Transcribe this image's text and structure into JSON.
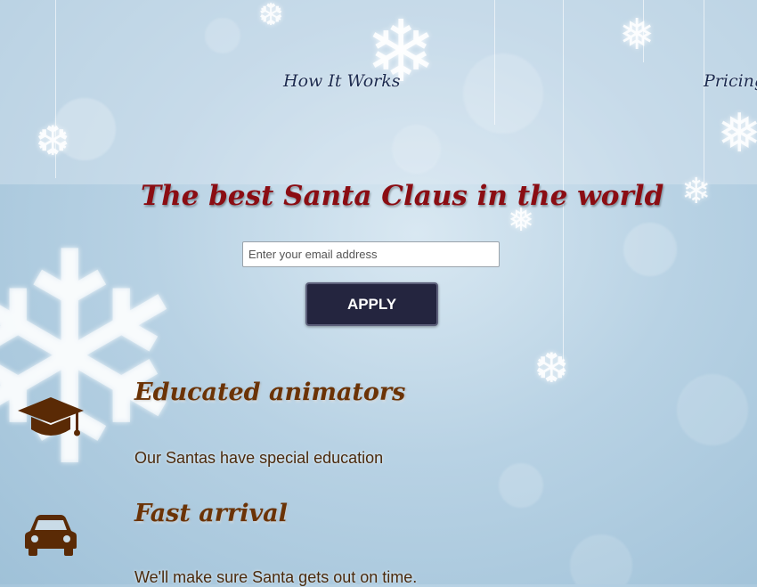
{
  "nav": {
    "items": [
      {
        "label": "How It Works"
      },
      {
        "label": "Pricing"
      }
    ]
  },
  "hero": {
    "title": "The best Santa Claus in the world",
    "email_placeholder": "Enter your email address",
    "apply_label": "APPLY"
  },
  "features": [
    {
      "icon": "graduation-cap-icon",
      "title": "Educated animators",
      "text": "Our Santas have special education"
    },
    {
      "icon": "car-icon",
      "title": "Fast arrival",
      "text": "We'll make sure Santa gets out on time."
    }
  ],
  "colors": {
    "title": "#8b0d13",
    "nav": "#1b2a4f",
    "feature_title": "#6b3306",
    "button_bg": "#24253f"
  }
}
